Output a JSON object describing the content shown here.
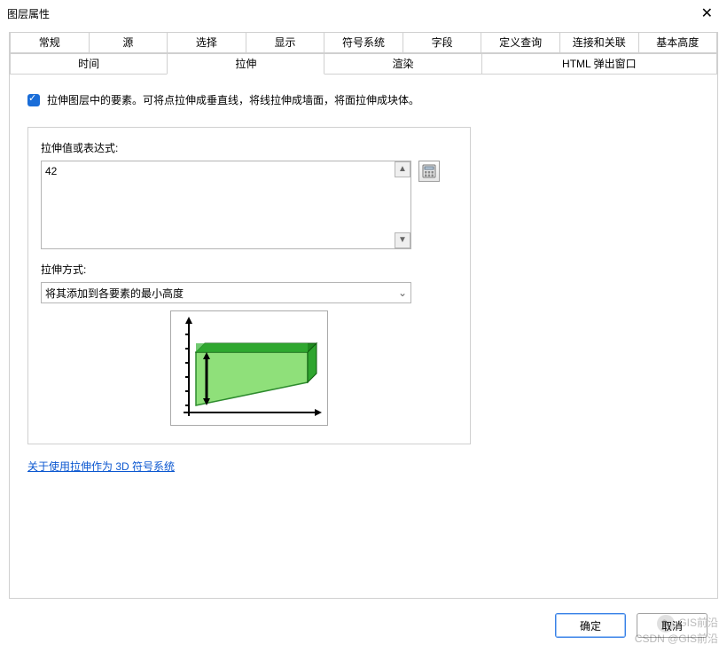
{
  "window": {
    "title": "图层属性",
    "close_icon": "✕"
  },
  "tabs_row1": [
    {
      "label": "常规"
    },
    {
      "label": "源"
    },
    {
      "label": "选择"
    },
    {
      "label": "显示"
    },
    {
      "label": "符号系统"
    },
    {
      "label": "字段"
    },
    {
      "label": "定义查询"
    },
    {
      "label": "连接和关联"
    },
    {
      "label": "基本高度"
    }
  ],
  "tabs_row2": [
    {
      "label": "时间"
    },
    {
      "label": "拉伸",
      "active": true
    },
    {
      "label": "渲染"
    },
    {
      "label": "HTML 弹出窗口"
    }
  ],
  "panel": {
    "checkbox_text": "拉伸图层中的要素。可将点拉伸成垂直线，将线拉伸成墙面，将面拉伸成块体。",
    "expr_label": "拉伸值或表达式:",
    "expr_value": "42",
    "calc_icon": "calculator-icon",
    "method_label": "拉伸方式:",
    "method_selected": "将其添加到各要素的最小高度",
    "help_link": "关于使用拉伸作为 3D 符号系统"
  },
  "buttons": {
    "ok": "确定",
    "cancel": "取消"
  },
  "watermark": {
    "line1": "GIS前沿",
    "line2": "CSDN @GIS前沿"
  }
}
